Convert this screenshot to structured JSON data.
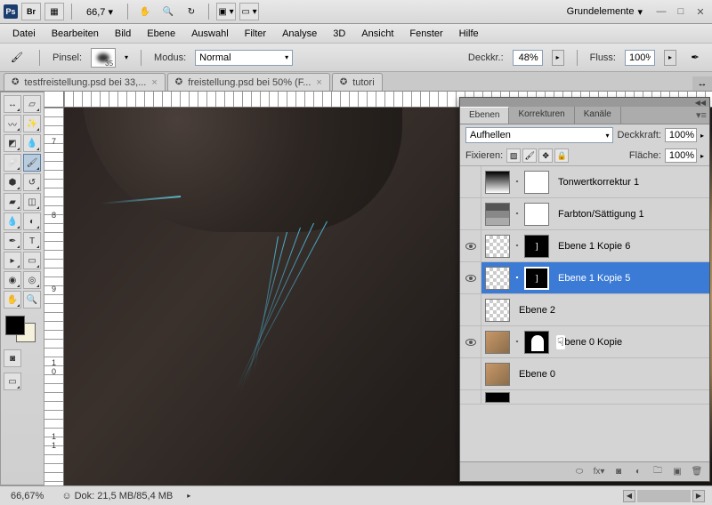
{
  "titlebar": {
    "zoom": "66,7",
    "workspace": "Grundelemente"
  },
  "menu": {
    "items": [
      "Datei",
      "Bearbeiten",
      "Bild",
      "Ebene",
      "Auswahl",
      "Filter",
      "Analyse",
      "3D",
      "Ansicht",
      "Fenster",
      "Hilfe"
    ]
  },
  "options": {
    "brush_label": "Pinsel:",
    "brush_size": "35",
    "mode_label": "Modus:",
    "mode_value": "Normal",
    "opacity_label": "Deckkr.:",
    "opacity_value": "48%",
    "flow_label": "Fluss:",
    "flow_value": "100%"
  },
  "tabs": [
    {
      "label": "testfreistellung.psd bei 33,..."
    },
    {
      "label": "freistellung.psd bei 50% (F..."
    },
    {
      "label": "tutori"
    }
  ],
  "rulers": {
    "left_ticks": [
      "",
      "7",
      "8",
      "9",
      "1\n0",
      "1\n1"
    ]
  },
  "layers_panel": {
    "tabs": [
      "Ebenen",
      "Korrekturen",
      "Kanäle"
    ],
    "blend_mode": "Aufhellen",
    "opacity_label": "Deckkraft:",
    "opacity_value": "100%",
    "lock_label": "Fixieren:",
    "fill_label": "Fläche:",
    "fill_value": "100%",
    "layers": [
      {
        "name": "Tonwertkorrektur 1",
        "visible": false,
        "type": "levels",
        "selected": false
      },
      {
        "name": "Farbton/Sättigung 1",
        "visible": false,
        "type": "hue",
        "selected": false
      },
      {
        "name": "Ebene 1 Kopie 6",
        "visible": true,
        "type": "layer-mask",
        "selected": false
      },
      {
        "name": "Ebene 1 Kopie 5",
        "visible": true,
        "type": "layer-mask",
        "selected": true
      },
      {
        "name": "Ebene 2",
        "visible": false,
        "type": "plain",
        "selected": false
      },
      {
        "name": "Ebene 0 Kopie",
        "visible": true,
        "type": "photo-sil",
        "selected": false
      },
      {
        "name": "Ebene 0",
        "visible": false,
        "type": "photo",
        "selected": false
      }
    ]
  },
  "status": {
    "zoom": "66,67%",
    "doc": "Dok: 21,5 MB/85,4 MB"
  }
}
